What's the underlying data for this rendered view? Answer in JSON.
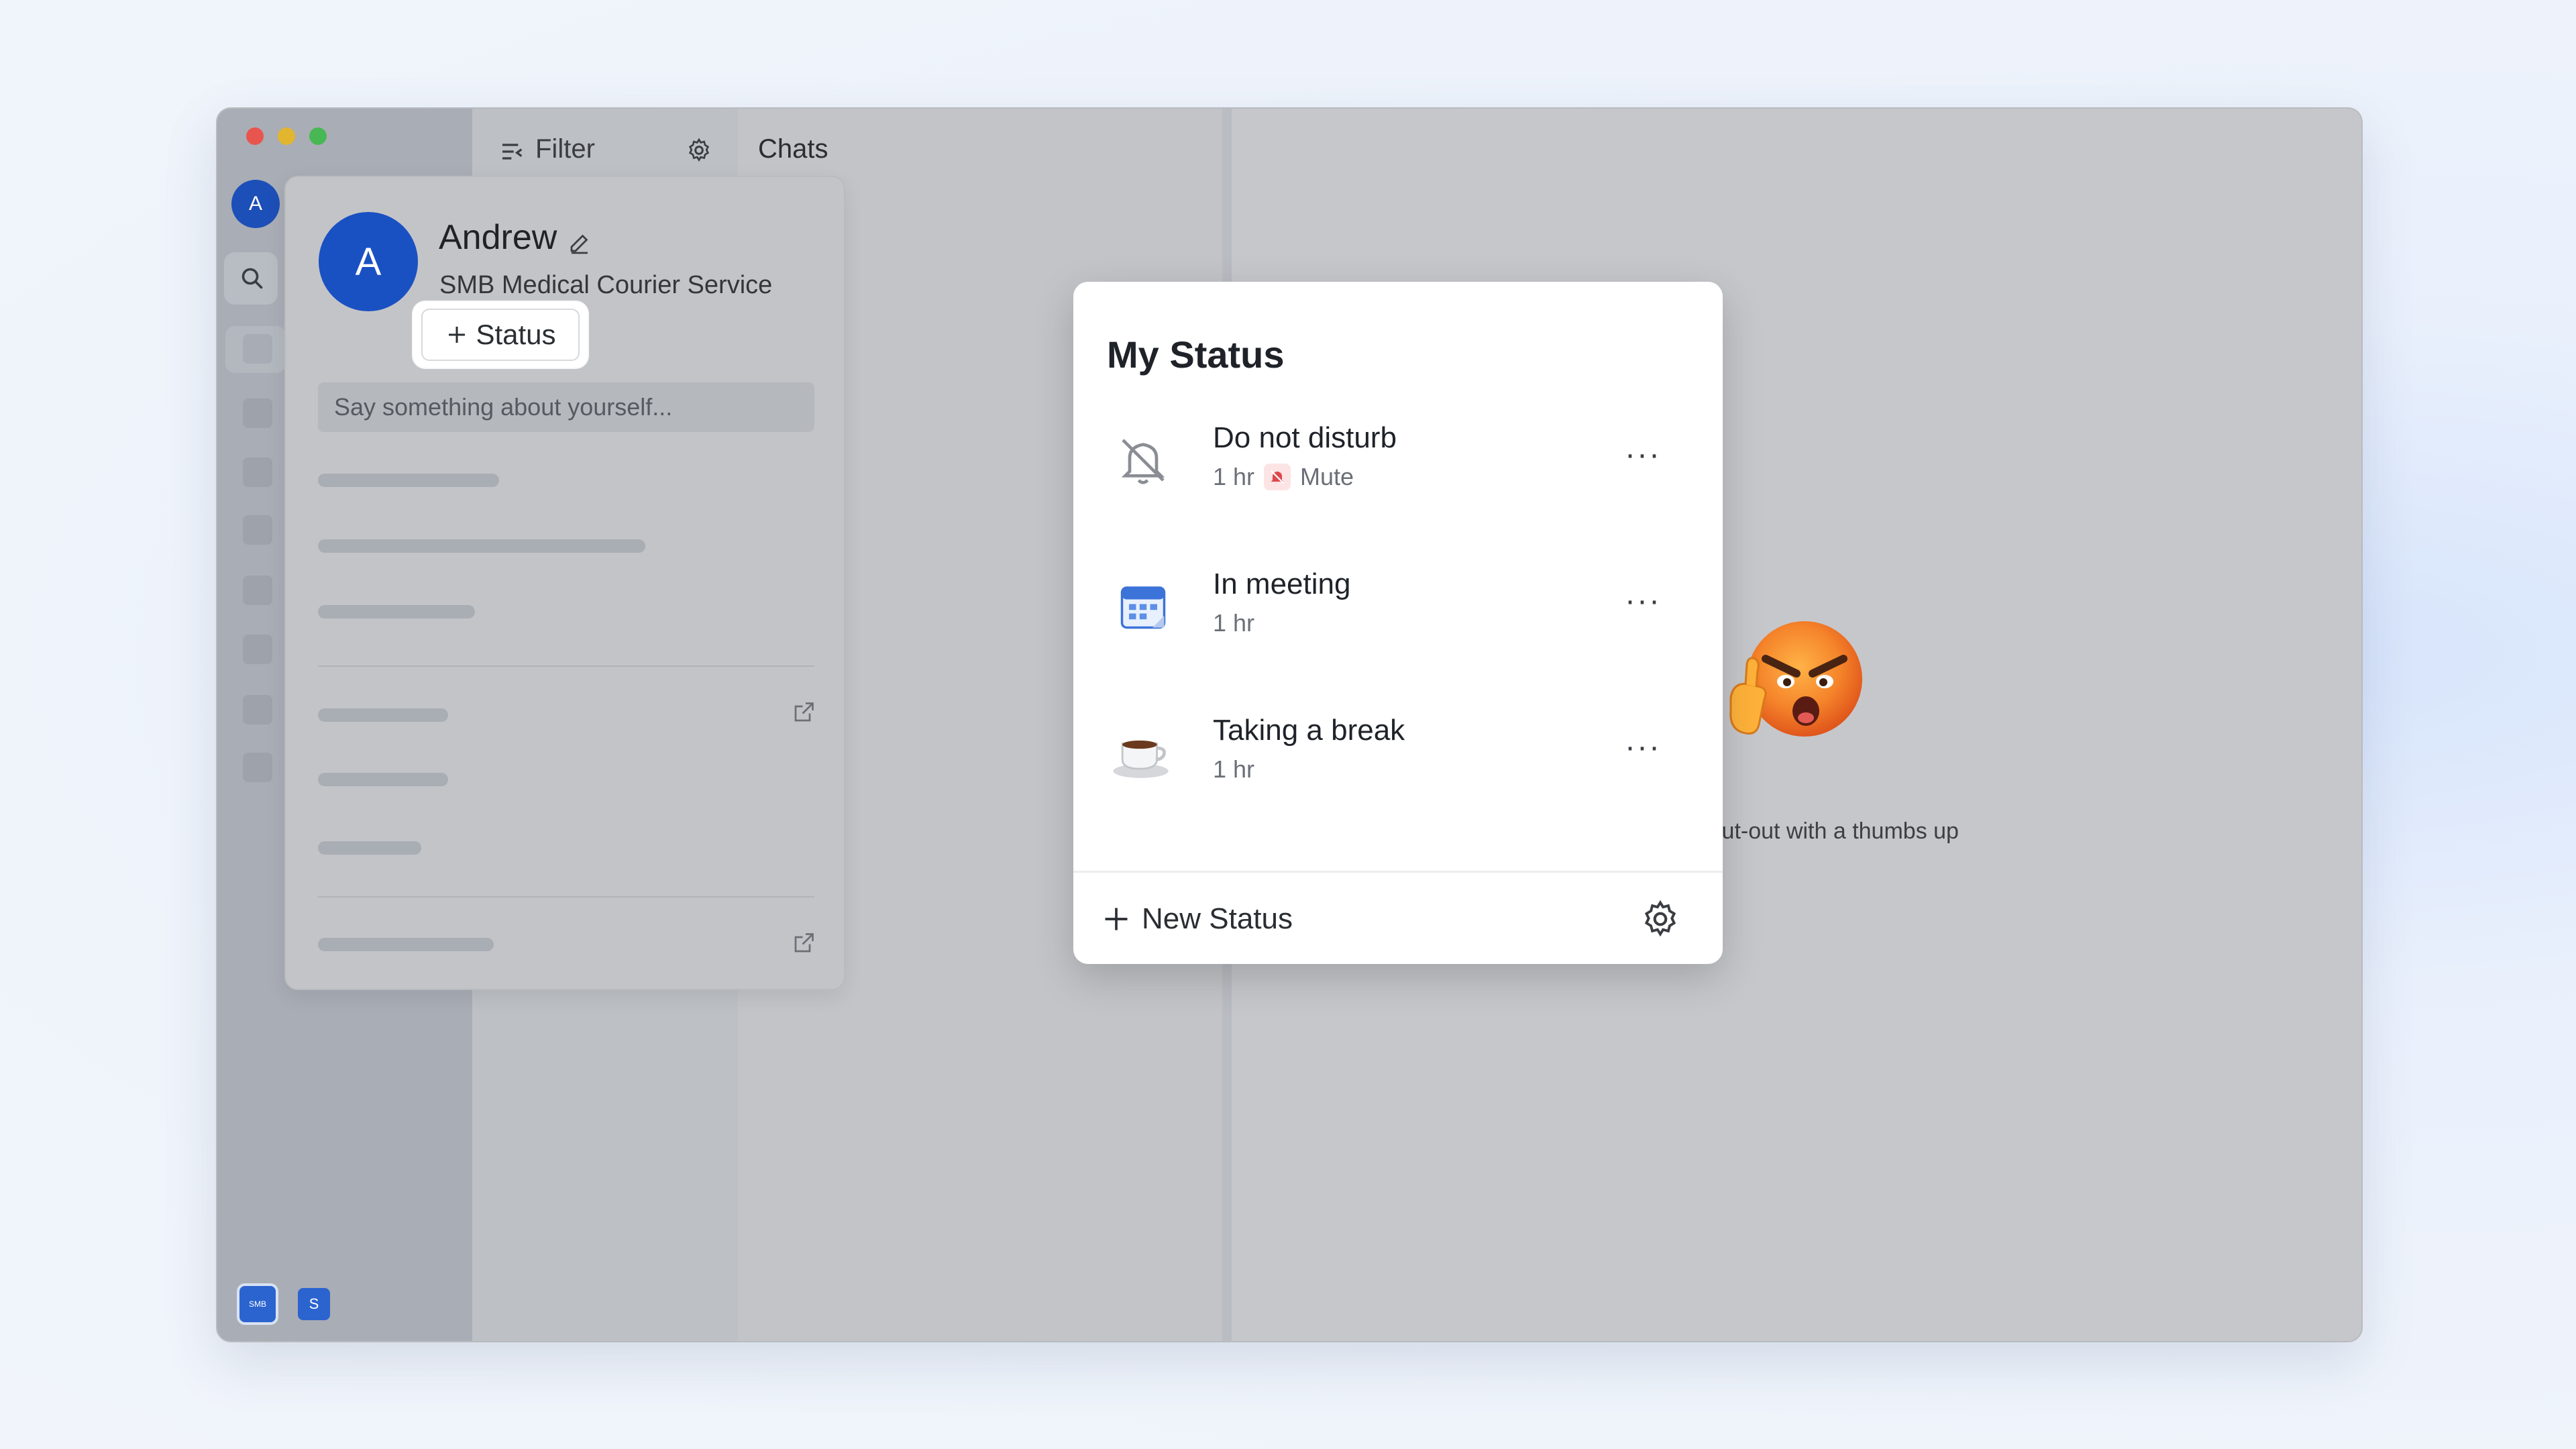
{
  "rail": {
    "avatar_initial": "A",
    "workspaces": [
      "SMB",
      "S"
    ]
  },
  "filter": {
    "label": "Filter"
  },
  "chats": {
    "label": "Chats"
  },
  "profile": {
    "initial": "A",
    "name": "Andrew",
    "organization": "SMB Medical Courier Service",
    "status_button": "Status",
    "bio_placeholder": "Say something about yourself..."
  },
  "status_panel": {
    "title": "My Status",
    "items": [
      {
        "name": "Do not disturb",
        "duration": "1 hr",
        "extra": "Mute",
        "icon": "bell-off-icon"
      },
      {
        "name": "In meeting",
        "duration": "1 hr",
        "icon": "calendar-icon"
      },
      {
        "name": "Taking a break",
        "duration": "1 hr",
        "icon": "coffee-icon"
      }
    ],
    "new_status": "New Status"
  },
  "main": {
    "empty_text": "Give a shout-out with a thumbs up"
  },
  "colors": {
    "accent": "#1a51c2",
    "window_bg": "#c4c6ca",
    "mute": "#e0474c"
  }
}
